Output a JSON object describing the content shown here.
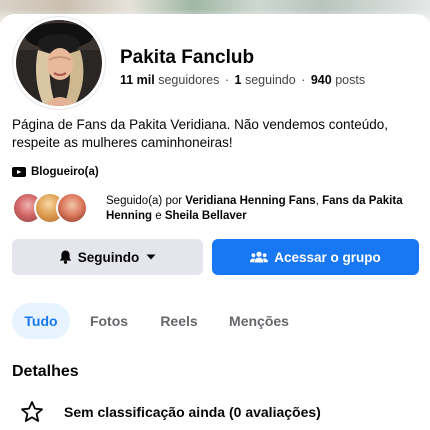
{
  "page": {
    "name": "Pakita Fanclub",
    "stats": {
      "followers_count": "11 mil",
      "followers_label": "seguidores",
      "following_count": "1",
      "following_label": "seguindo",
      "posts_count": "940",
      "posts_label": "posts",
      "separator": "·"
    },
    "bio": "Página de Fans da Pakita Veridiana. Não vendemos conteúdo, respeite as mulheres caminhoneiras!",
    "category": {
      "icon": "video-icon",
      "label": "Blogueiro(a)"
    }
  },
  "followed_by": {
    "prefix": "Seguido(a) por",
    "name1": "Veridiana Henning Fans",
    "comma": ",",
    "name2": "Fans da Pakita Henning",
    "conjunction": "e",
    "name3": "Sheila Bellaver"
  },
  "actions": {
    "follow_label": "Seguindo",
    "group_label": "Acessar o grupo",
    "accent_color": "#1877f2"
  },
  "tabs": [
    {
      "label": "Tudo",
      "active": true
    },
    {
      "label": "Fotos",
      "active": false
    },
    {
      "label": "Reels",
      "active": false
    },
    {
      "label": "Menções",
      "active": false
    }
  ],
  "details": {
    "title": "Detalhes",
    "rating_icon": "star-outline-icon",
    "rating_text": "Sem classificação ainda (0 avaliações)"
  }
}
